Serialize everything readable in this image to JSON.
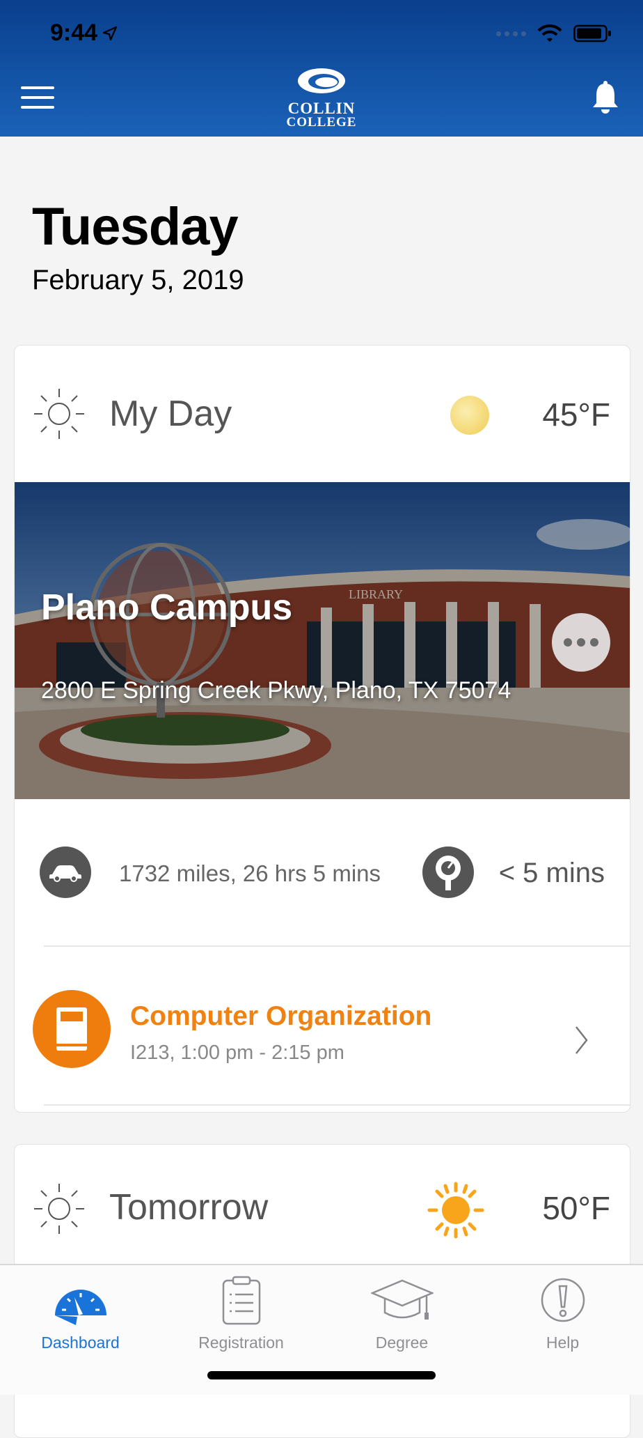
{
  "status_bar": {
    "time": "9:44"
  },
  "header": {
    "logo_line1": "COLLIN",
    "logo_line2": "COLLEGE"
  },
  "today": {
    "weekday": "Tuesday",
    "date": "February 5, 2019"
  },
  "my_day": {
    "title": "My Day",
    "temperature": "45°F",
    "campus": {
      "name": "Plano Campus",
      "address": "2800 E Spring Creek Pkwy, Plano, TX 75074",
      "building_sign": "LIBRARY"
    },
    "drive": "1732 miles, 26 hrs 5 mins",
    "transit": "< 5 mins",
    "class": {
      "name": "Computer Organization",
      "details": "I213, 1:00 pm - 2:15 pm"
    }
  },
  "tomorrow": {
    "title": "Tomorrow",
    "temperature": "50°F"
  },
  "tabs": [
    {
      "label": "Dashboard",
      "icon": "gauge-icon"
    },
    {
      "label": "Registration",
      "icon": "clipboard-icon"
    },
    {
      "label": "Degree",
      "icon": "graduation-cap-icon"
    },
    {
      "label": "Help",
      "icon": "exclamation-icon"
    }
  ],
  "colors": {
    "brand_blue": "#1a62b8",
    "accent_orange": "#ef8210",
    "active_tab": "#1a73d9"
  }
}
